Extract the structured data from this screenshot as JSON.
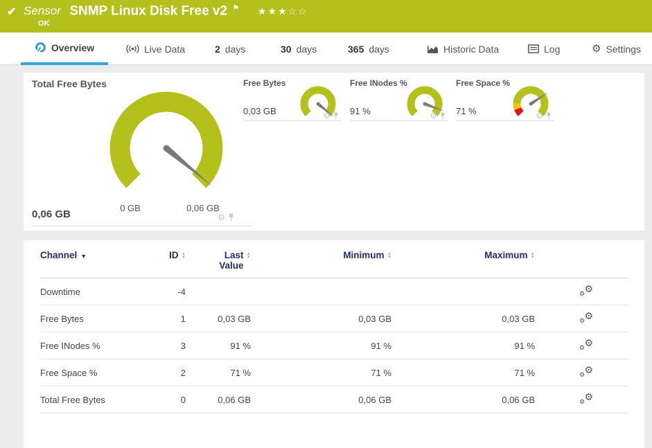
{
  "header": {
    "status_icon": "check-icon",
    "kind_label": "Sensor",
    "title": "SNMP Linux Disk Free v2",
    "stars_filled": "★★★",
    "stars_empty": "☆☆",
    "status_text": "OK",
    "bar_color": "#b4c11d"
  },
  "tabs": [
    {
      "icon": "gauge-icon",
      "label": "Overview",
      "active": true
    },
    {
      "icon": "live-icon",
      "label": "Live Data"
    },
    {
      "num": "2",
      "label": "days"
    },
    {
      "num": "30",
      "label": "days"
    },
    {
      "num": "365",
      "label": "days"
    },
    {
      "icon": "chart-icon",
      "label": "Historic Data"
    },
    {
      "icon": "log-icon",
      "label": "Log"
    },
    {
      "icon": "gear-icon",
      "label": "Settings"
    }
  ],
  "gauges": {
    "needle_color": "#7a7a7a",
    "primary": {
      "title": "Total Free Bytes",
      "value": "0,06 GB",
      "value_pct": 98,
      "scale_min": "0 GB",
      "scale_max": "0,06 GB",
      "segments": [
        {
          "from": 0,
          "to": 100,
          "color": "#b4c11d"
        }
      ]
    },
    "small": [
      {
        "title": "Free Bytes",
        "value": "0,03 GB",
        "value_pct": 98,
        "segments": [
          {
            "from": 0,
            "to": 100,
            "color": "#b4c11d"
          }
        ]
      },
      {
        "title": "Free INodes %",
        "value": "91 %",
        "value_pct": 91,
        "segments": [
          {
            "from": 0,
            "to": 100,
            "color": "#b4c11d"
          }
        ]
      },
      {
        "title": "Free Space %",
        "value": "71 %",
        "value_pct": 71,
        "segments": [
          {
            "from": 0,
            "to": 9,
            "color": "#d71920"
          },
          {
            "from": 9,
            "to": 17,
            "color": "#f5c500"
          },
          {
            "from": 17,
            "to": 100,
            "color": "#b4c11d"
          }
        ]
      }
    ]
  },
  "table": {
    "columns": {
      "channel": "Channel",
      "id": "ID",
      "last": "Last Value",
      "min": "Minimum",
      "max": "Maximum"
    },
    "rows": [
      {
        "channel": "Downtime",
        "id": "-4",
        "last": "",
        "min": "",
        "max": ""
      },
      {
        "channel": "Free Bytes",
        "id": "1",
        "last": "0,03 GB",
        "min": "0,03 GB",
        "max": "0,03 GB"
      },
      {
        "channel": "Free INodes %",
        "id": "3",
        "last": "91 %",
        "min": "91 %",
        "max": "91 %"
      },
      {
        "channel": "Free Space %",
        "id": "2",
        "last": "71 %",
        "min": "71 %",
        "max": "71 %"
      },
      {
        "channel": "Total Free Bytes",
        "id": "0",
        "last": "0,06 GB",
        "min": "0,06 GB",
        "max": "0,06 GB"
      }
    ]
  }
}
